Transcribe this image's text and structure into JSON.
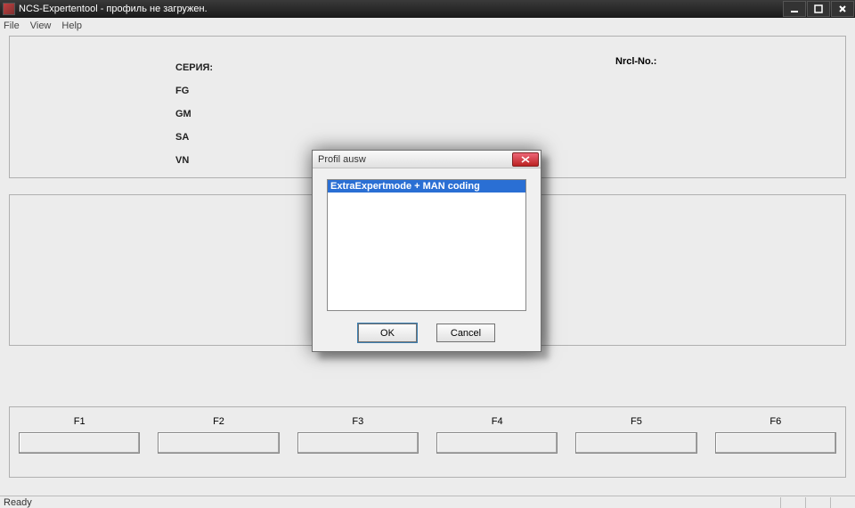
{
  "window": {
    "title": "NCS-Expertentool - профиль не загружен.",
    "menu": {
      "file": "File",
      "view": "View",
      "help": "Help"
    }
  },
  "panel": {
    "seria": "СЕРИЯ:",
    "fg": "FG",
    "gm": "GM",
    "sa": "SA",
    "vn": "VN",
    "nrcl": "Nrcl-No.:"
  },
  "fkeys": {
    "f1": "F1",
    "f2": "F2",
    "f3": "F3",
    "f4": "F4",
    "f5": "F5",
    "f6": "F6"
  },
  "status": "Ready",
  "dialog": {
    "title": "Profil ausw",
    "item1": "ExtraExpertmode + MAN coding",
    "ok": "OK",
    "cancel": "Cancel"
  }
}
